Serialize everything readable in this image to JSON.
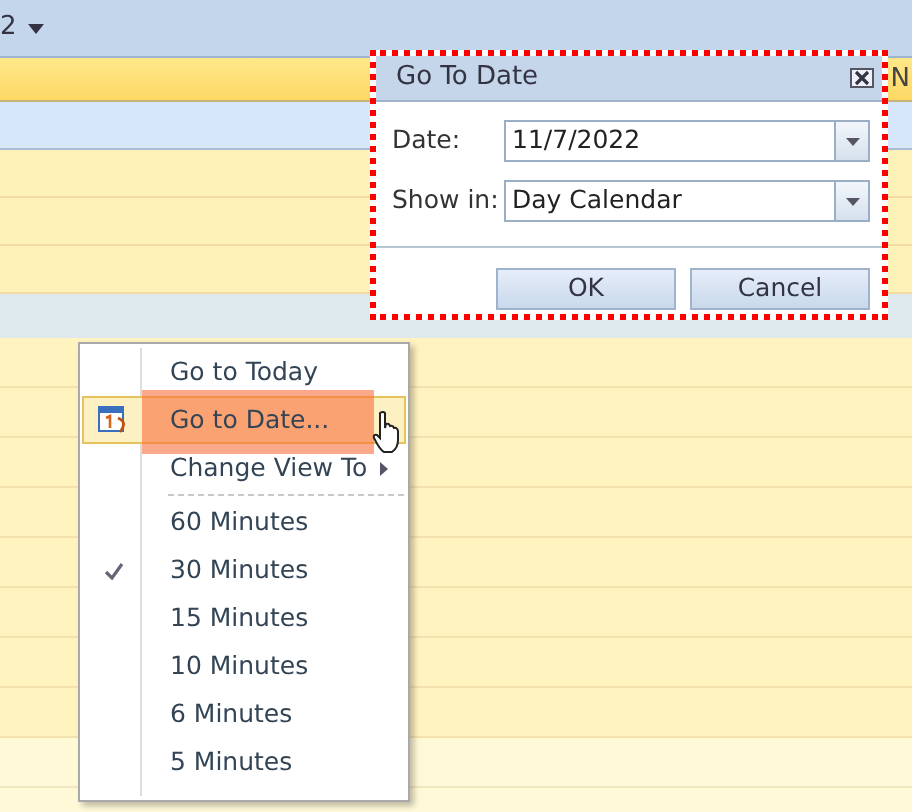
{
  "toolbar": {
    "text": "2"
  },
  "header": {
    "column_label": "N"
  },
  "dialog": {
    "title": "Go To Date",
    "fields": [
      {
        "label": "Date:",
        "value": "11/7/2022"
      },
      {
        "label": "Show in:",
        "value": "Day Calendar"
      }
    ],
    "buttons": [
      "OK",
      "Cancel"
    ]
  },
  "context_menu": {
    "items": [
      {
        "kind": "item",
        "label": "Go to Today",
        "selected": false,
        "checked": false
      },
      {
        "kind": "item",
        "label": "Go to Date...",
        "selected": true,
        "checked": false
      },
      {
        "kind": "submenu",
        "label": "Change View To",
        "selected": false,
        "checked": false
      },
      {
        "kind": "separator"
      },
      {
        "kind": "item",
        "label": "60 Minutes",
        "selected": false,
        "checked": false
      },
      {
        "kind": "item",
        "label": "30 Minutes",
        "selected": false,
        "checked": true
      },
      {
        "kind": "item",
        "label": "15 Minutes",
        "selected": false,
        "checked": false
      },
      {
        "kind": "item",
        "label": "10 Minutes",
        "selected": false,
        "checked": false
      },
      {
        "kind": "item",
        "label": "6 Minutes",
        "selected": false,
        "checked": false
      },
      {
        "kind": "item",
        "label": "5 Minutes",
        "selected": false,
        "checked": false
      }
    ]
  }
}
